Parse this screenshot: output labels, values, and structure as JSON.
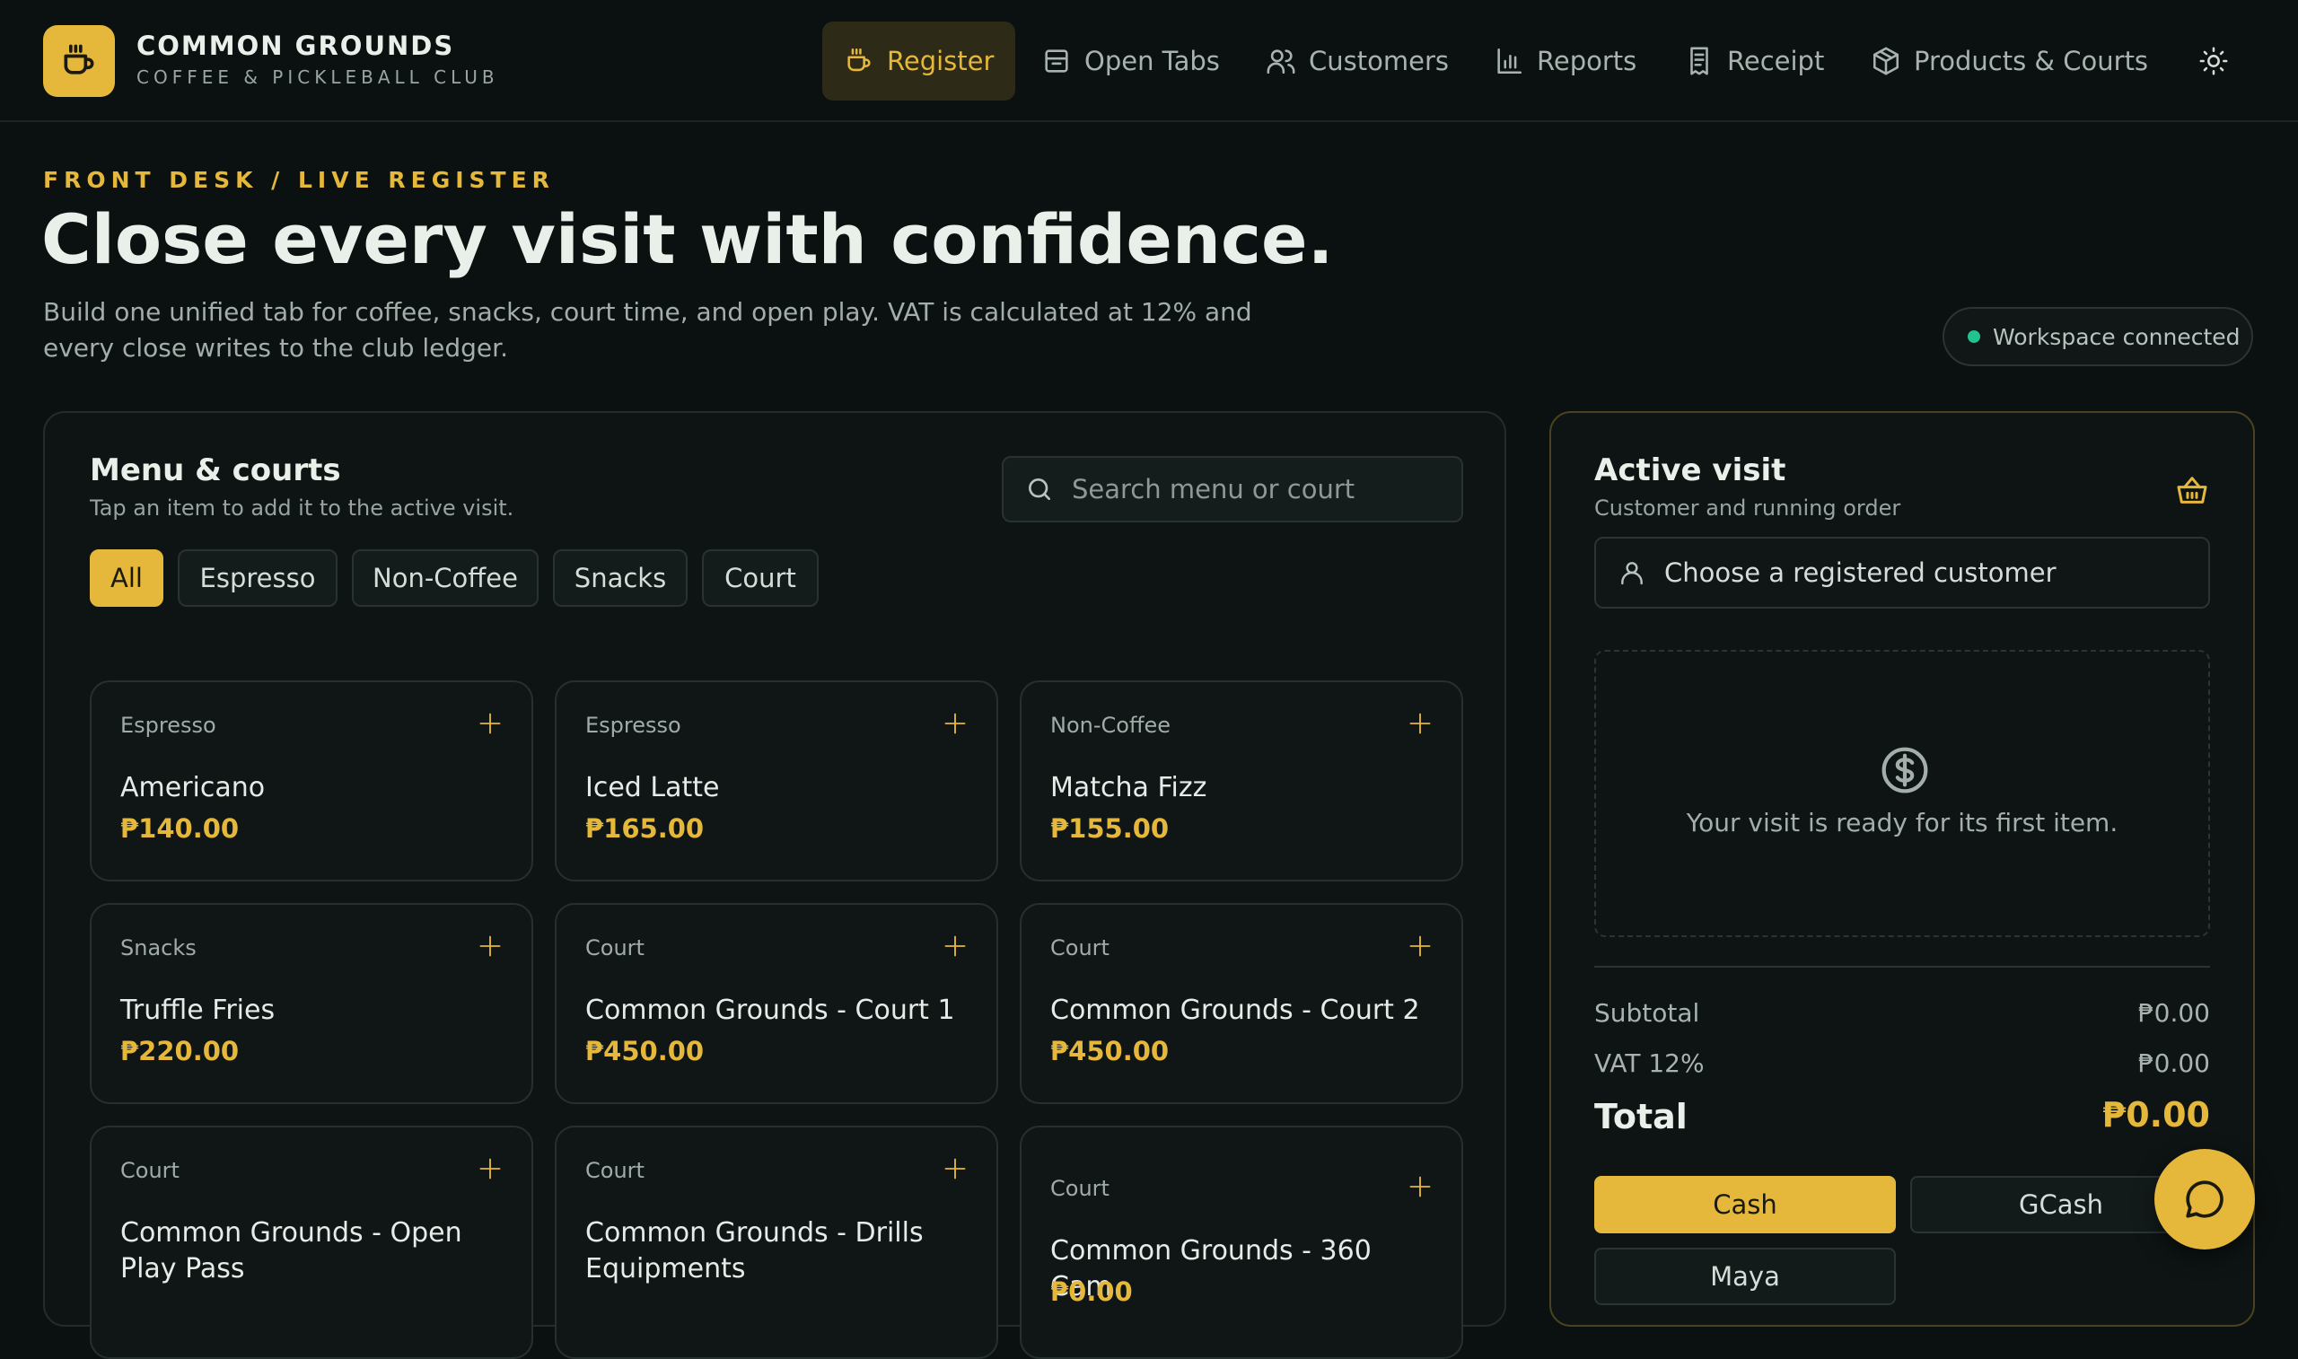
{
  "brand": {
    "name": "COMMON GROUNDS",
    "subtitle": "COFFEE & PICKLEBALL CLUB"
  },
  "nav": [
    {
      "label": "Register",
      "icon": "coffee-cup-icon",
      "active": true
    },
    {
      "label": "Open Tabs",
      "icon": "tab-icon"
    },
    {
      "label": "Customers",
      "icon": "users-icon"
    },
    {
      "label": "Reports",
      "icon": "bar-chart-icon"
    },
    {
      "label": "Receipt",
      "icon": "receipt-icon"
    },
    {
      "label": "Products & Courts",
      "icon": "box-icon"
    }
  ],
  "hero": {
    "eyebrow": "FRONT DESK / LIVE REGISTER",
    "title": "Close every visit with confidence.",
    "description": "Build one unified tab for coffee, snacks, court time, and open play. VAT is calculated at 12% and every close writes to the club ledger."
  },
  "status": {
    "label": "Workspace connected",
    "color": "#22c38e"
  },
  "menu": {
    "title": "Menu & courts",
    "subtitle": "Tap an item to add it to the active visit.",
    "search_placeholder": "Search menu or court",
    "filters": [
      "All",
      "Espresso",
      "Non-Coffee",
      "Snacks",
      "Court"
    ],
    "active_filter": "All",
    "items": [
      {
        "category": "Espresso",
        "name": "Americano",
        "price": "₱140.00"
      },
      {
        "category": "Espresso",
        "name": "Iced Latte",
        "price": "₱165.00"
      },
      {
        "category": "Non-Coffee",
        "name": "Matcha Fizz",
        "price": "₱155.00"
      },
      {
        "category": "Snacks",
        "name": "Truffle Fries",
        "price": "₱220.00"
      },
      {
        "category": "Court",
        "name": "Common Grounds - Court 1",
        "price": "₱450.00"
      },
      {
        "category": "Court",
        "name": "Common Grounds - Court 2",
        "price": "₱450.00"
      },
      {
        "category": "Court",
        "name": "Common Grounds - Open Play Pass",
        "price": ""
      },
      {
        "category": "Court",
        "name": "Common Grounds - Drills Equipments",
        "price": ""
      },
      {
        "category": "Court",
        "name": "Common Grounds - 360 Cam",
        "price": "₱0.00"
      }
    ]
  },
  "visit": {
    "title": "Active visit",
    "subtitle": "Customer and running order",
    "customer_placeholder": "Choose a registered customer",
    "empty_message": "Your visit is ready for its first item.",
    "subtotal_label": "Subtotal",
    "subtotal": "₱0.00",
    "vat_label": "VAT 12%",
    "vat": "₱0.00",
    "total_label": "Total",
    "total": "₱0.00",
    "payment_methods": [
      "Cash",
      "GCash",
      "Maya"
    ],
    "active_payment": "Cash"
  },
  "colors": {
    "accent": "#e5b73b",
    "background": "#0b1110",
    "connected": "#22c38e"
  }
}
